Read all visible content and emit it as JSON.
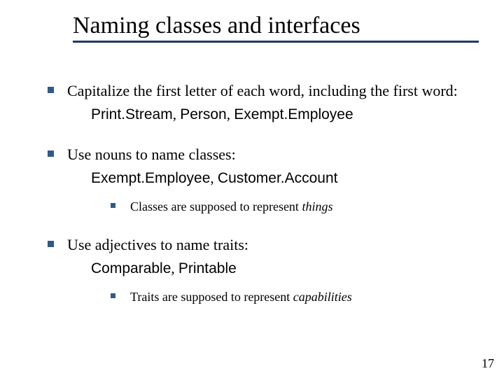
{
  "title": "Naming classes and interfaces",
  "bullets": [
    {
      "text": "Capitalize the first letter of each word, including the first word:",
      "examples": [
        "Print.Stream",
        "Person",
        "Exempt.Employee"
      ],
      "sub": null
    },
    {
      "text": "Use nouns to name classes:",
      "examples": [
        "Exempt.Employee",
        "Customer.Account"
      ],
      "sub": {
        "prefix": "Classes are supposed to represent ",
        "em": "things"
      }
    },
    {
      "text": "Use adjectives to name traits:",
      "examples": [
        "Comparable",
        "Printable"
      ],
      "sub": {
        "prefix": "Traits are supposed to represent ",
        "em": "capabilities"
      }
    }
  ],
  "sep": ", ",
  "page_number": "17"
}
